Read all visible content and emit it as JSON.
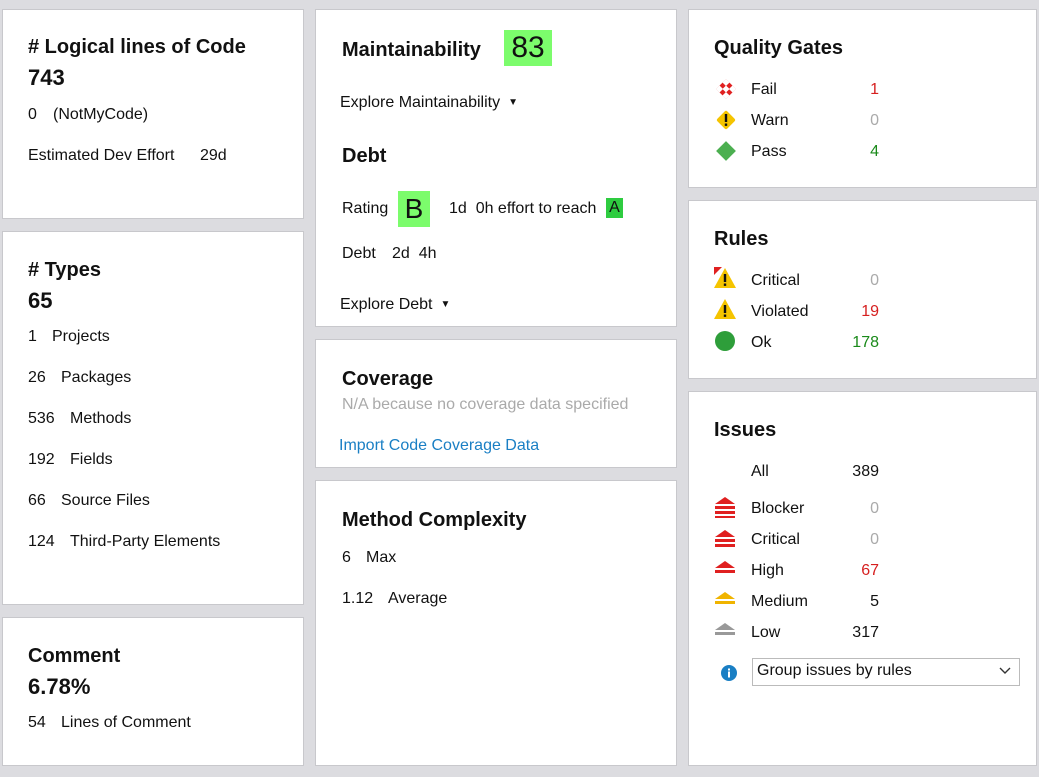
{
  "loc": {
    "title": "# Logical lines of Code",
    "value": "743",
    "notmycode_count": "0",
    "notmycode_label": "(NotMyCode)",
    "effort_label": "Estimated Dev Effort",
    "effort_value": "29d"
  },
  "types": {
    "title": "# Types",
    "value": "65",
    "rows": [
      {
        "count": "1",
        "label": "Projects"
      },
      {
        "count": "26",
        "label": "Packages"
      },
      {
        "count": "536",
        "label": "Methods"
      },
      {
        "count": "192",
        "label": "Fields"
      },
      {
        "count": "66",
        "label": "Source Files"
      },
      {
        "count": "124",
        "label": "Third-Party Elements"
      }
    ]
  },
  "comment": {
    "title": "Comment",
    "value": "6.78%",
    "lines_count": "54",
    "lines_label": "Lines of Comment"
  },
  "maintainability": {
    "title": "Maintainability",
    "score": "83",
    "explore_label": "Explore Maintainability"
  },
  "debt": {
    "title": "Debt",
    "rating_label": "Rating",
    "rating": "B",
    "effort_text": "1d  0h effort to reach",
    "target_rating": "A",
    "debt_label": "Debt",
    "debt_value": "2d  4h",
    "explore_label": "Explore Debt"
  },
  "coverage": {
    "title": "Coverage",
    "note": "N/A because no coverage data specified",
    "import_link": "Import Code Coverage Data"
  },
  "complexity": {
    "title": "Method Complexity",
    "max_value": "6",
    "max_label": "Max",
    "avg_value": "1.12",
    "avg_label": "Average"
  },
  "quality_gates": {
    "title": "Quality Gates",
    "rows": [
      {
        "icon": "fail-icon",
        "label": "Fail",
        "count": "1"
      },
      {
        "icon": "warn-icon",
        "label": "Warn",
        "count": "0"
      },
      {
        "icon": "pass-icon",
        "label": "Pass",
        "count": "4"
      }
    ]
  },
  "rules": {
    "title": "Rules",
    "rows": [
      {
        "icon": "critical-rule-icon",
        "label": "Critical",
        "count": "0"
      },
      {
        "icon": "violated-rule-icon",
        "label": "Violated",
        "count": "19"
      },
      {
        "icon": "ok-rule-icon",
        "label": "Ok",
        "count": "178"
      }
    ]
  },
  "issues": {
    "title": "Issues",
    "all_label": "All",
    "all_count": "389",
    "rows": [
      {
        "icon": "blocker-icon",
        "label": "Blocker",
        "count": "0"
      },
      {
        "icon": "critical-icon",
        "label": "Critical",
        "count": "0"
      },
      {
        "icon": "high-icon",
        "label": "High",
        "count": "67"
      },
      {
        "icon": "medium-icon",
        "label": "Medium",
        "count": "5"
      },
      {
        "icon": "low-icon",
        "label": "Low",
        "count": "317"
      }
    ],
    "group_select": "Group issues by rules"
  },
  "colors": {
    "badge_green": "#7cfc6c",
    "rating_a_green": "#2ecc40",
    "link_blue": "#1a7fc4",
    "red": "#d61f1f",
    "green": "#1a8a1a"
  }
}
